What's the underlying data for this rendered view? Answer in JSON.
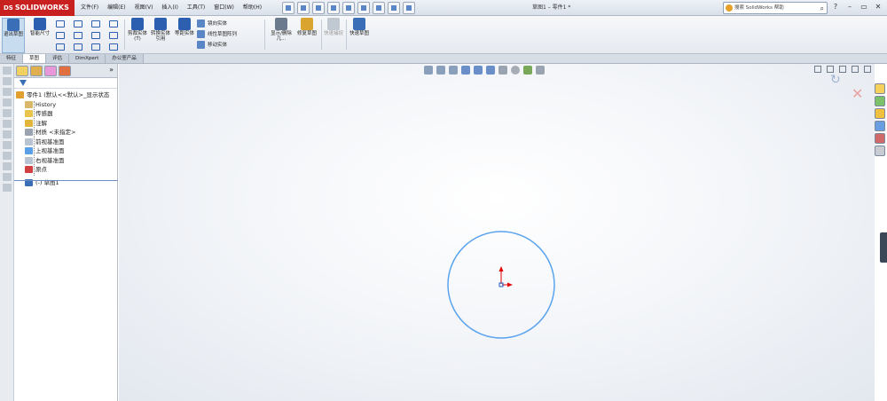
{
  "app": {
    "brand": "SOLIDWORKS",
    "brand_prefix": "DS",
    "document_title": "草图1 – 零件1 *"
  },
  "menu": [
    "文件(F)",
    "编辑(E)",
    "视图(V)",
    "插入(I)",
    "工具(T)",
    "窗口(W)",
    "帮助(H)"
  ],
  "search": {
    "placeholder": "搜索 SolidWorks 帮助"
  },
  "window_controls": [
    "?",
    "–",
    "▭",
    "✕"
  ],
  "command_manager": {
    "exit_sketch": "退出草图",
    "smart_dimension": "智能尺寸",
    "trim": "剪裁实体(T)",
    "convert": "转换实体引用",
    "offset": "等距实体",
    "mirror": "镜向实体",
    "linear_pattern": "线性草图阵列",
    "move": "移动实体",
    "display_delete": "显示/删除几...",
    "repair": "修复草图",
    "quick_snaps": "快速捕捉",
    "rapid_sketch": "快速草图"
  },
  "tabs": [
    "特征",
    "草图",
    "评估",
    "DimXpert",
    "办公室产品"
  ],
  "active_tab": 1,
  "feature_tree": {
    "root": "零件1 (默认<<默认>_显示状态",
    "items": [
      "History",
      "传感器",
      "注解",
      "材质 <未指定>",
      "前视基准面",
      "上视基准面",
      "右视基准面",
      "原点",
      "(-) 草图1"
    ]
  },
  "colors": {
    "circle": "#5aa3ee",
    "axis_y": "#e00000",
    "axis_x": "#e00000",
    "origin": "#2060c0",
    "brand": "#c8201e"
  },
  "icons": {
    "confirm_ok": "↻",
    "confirm_cancel": "✕",
    "fm_more": "»",
    "search_go": "⌕"
  }
}
